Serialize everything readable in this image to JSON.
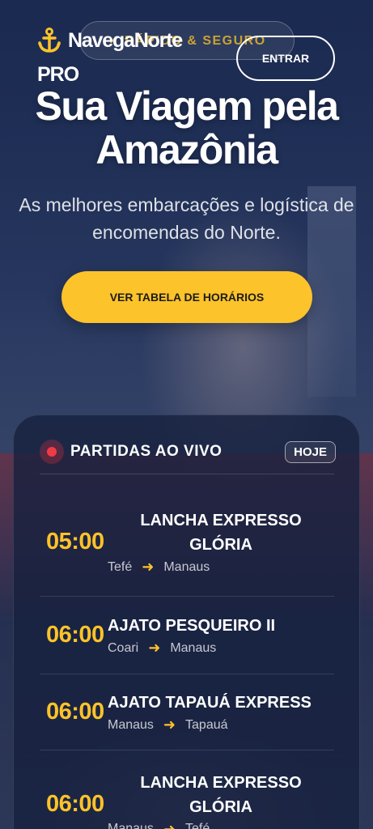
{
  "header": {
    "brand_name": "NavegaNorte",
    "brand_suffix": "PRO",
    "tag_pill": "✓ RÁPIDO & SEGURO",
    "login_label": "ENTRAR"
  },
  "hero": {
    "title_line1": "Sua Viagem pela",
    "title_line2": "Amazônia",
    "subtitle": "As melhores embarcações e logística de encomendas do Norte.",
    "cta_label": "VER TABELA DE HORÁRIOS"
  },
  "live": {
    "title": "PARTIDAS AO VIVO",
    "badge": "HOJE",
    "departures": [
      {
        "time": "05:00",
        "name": "LANCHA EXPRESSO GLÓRIA",
        "from": "Tefé",
        "to": "Manaus"
      },
      {
        "time": "06:00",
        "name": "AJATO PESQUEIRO II",
        "from": "Coari",
        "to": "Manaus"
      },
      {
        "time": "06:00",
        "name": "AJATO TAPAUÁ EXPRESS",
        "from": "Manaus",
        "to": "Tapauá"
      },
      {
        "time": "06:00",
        "name": "LANCHA EXPRESSO GLÓRIA",
        "from": "Manaus",
        "to": "Tefé"
      }
    ]
  },
  "colors": {
    "accent": "#fdc32a",
    "live_dot": "#ef3b46",
    "background": "#1d2c51"
  },
  "icons": {
    "brand": "anchor-icon",
    "route": "arrow-right-icon",
    "live": "live-dot-icon"
  }
}
